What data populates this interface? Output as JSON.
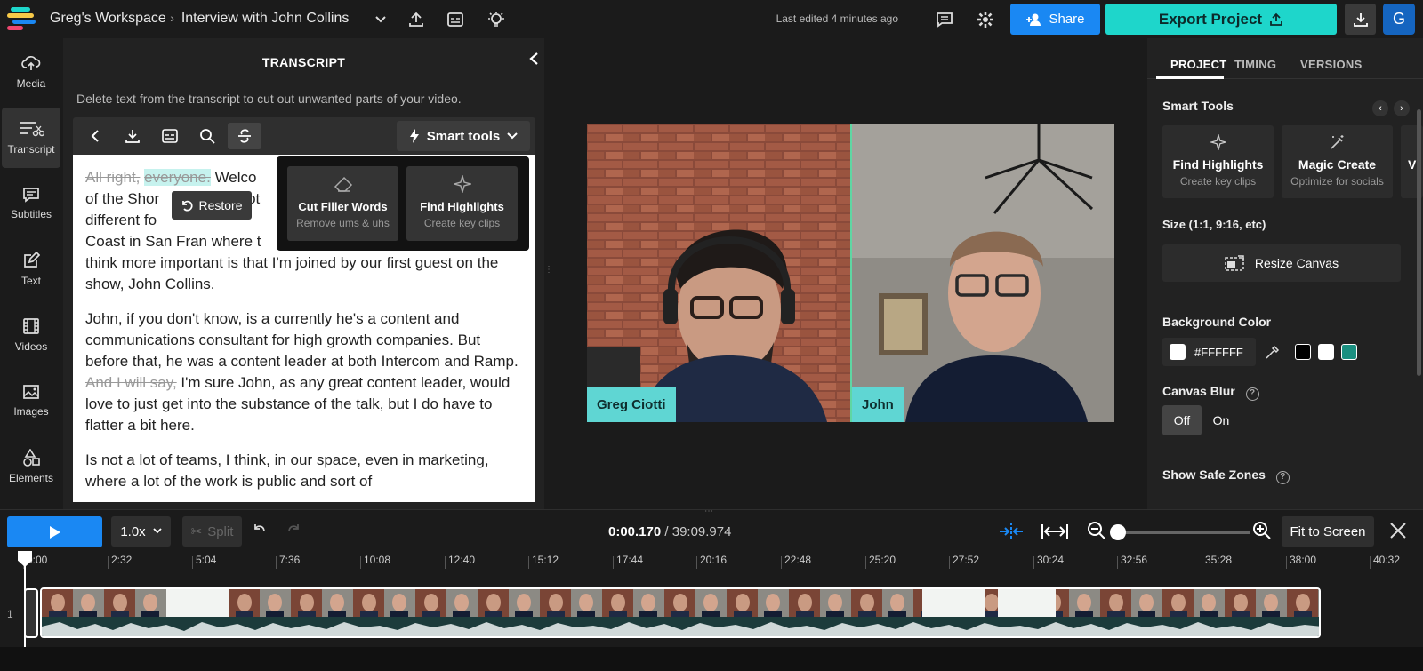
{
  "header": {
    "workspace": "Greg's Workspace",
    "project": "Interview with John Collins",
    "last_edited": "Last edited 4 minutes ago",
    "share_label": "Share",
    "export_label": "Export Project",
    "avatar_initial": "G"
  },
  "nav": [
    {
      "label": "Media",
      "icon": "upload-icon"
    },
    {
      "label": "Transcript",
      "icon": "transcript-icon"
    },
    {
      "label": "Subtitles",
      "icon": "subtitles-icon"
    },
    {
      "label": "Text",
      "icon": "text-icon"
    },
    {
      "label": "Videos",
      "icon": "film-icon"
    },
    {
      "label": "Images",
      "icon": "image-icon"
    },
    {
      "label": "Elements",
      "icon": "shapes-icon"
    }
  ],
  "transcript": {
    "title": "TRANSCRIPT",
    "hint": "Delete text from the transcript to cut out unwanted parts of your video.",
    "smart_tools_label": "Smart tools",
    "restore_label": "Restore",
    "p1_strike1": "All right,",
    "p1_strike2": "everyone.",
    "p1_line1": "Welco",
    "p1_line2": "of the Shor",
    "p1_line2b": "not",
    "p1_line3": "different fo",
    "p1_line4": "Coast in San Fran where t",
    "p1_rest": "think more important is that I'm joined by our first guest on the show, John Collins.",
    "p2_a": "John, if you don't know, is a currently he's a content and communications consultant for high growth companies. But before that, he was a content leader at both Intercom and Ramp.",
    "p2_strike": "And I will say,",
    "p2_b": "I'm sure John, as any great content leader, would love to just get into the substance of the talk, but I do have to flatter a bit here.",
    "p3": "Is not a lot of teams, I think, in our space, even in marketing, where a lot of the work is public and sort of"
  },
  "smart_popup": [
    {
      "title": "Cut Filler Words",
      "sub": "Remove ums & uhs",
      "icon": "eraser-icon"
    },
    {
      "title": "Find Highlights",
      "sub": "Create key clips",
      "icon": "sparkle-icon"
    }
  ],
  "video": {
    "left_name": "Greg Ciotti",
    "right_name": "John"
  },
  "right_panel": {
    "tabs": [
      "PROJECT",
      "TIMING",
      "VERSIONS"
    ],
    "smart_tools_heading": "Smart Tools",
    "cards": [
      {
        "title": "Find Highlights",
        "sub": "Create key clips"
      },
      {
        "title": "Magic Create",
        "sub": "Optimize for socials"
      },
      {
        "title": "V",
        "sub": ""
      }
    ],
    "size_heading": "Size (1:1, 9:16, etc)",
    "resize_label": "Resize Canvas",
    "bg_heading": "Background Color",
    "bg_value": "#FFFFFF",
    "blur_heading": "Canvas Blur",
    "blur_off": "Off",
    "blur_on": "On",
    "safe_heading": "Show Safe Zones"
  },
  "timeline": {
    "speed": "1.0x",
    "split_label": "Split",
    "current_time": "0:00.170",
    "total_time": "/ 39:09.974",
    "fit_label": "Fit to Screen",
    "zoom_level": 0,
    "track_number": "1",
    "ticks": [
      "0:00",
      "2:32",
      "5:04",
      "7:36",
      "10:08",
      "12:40",
      "15:12",
      "17:44",
      "20:16",
      "22:48",
      "25:20",
      "27:52",
      "30:24",
      "32:56",
      "35:28",
      "38:00",
      "40:32"
    ]
  },
  "colors": {
    "accent_blue": "#1a88f3",
    "export_teal": "#1ed6cb",
    "name_tag": "#5fd6d3",
    "swatch_teal": "#1a8f80"
  }
}
